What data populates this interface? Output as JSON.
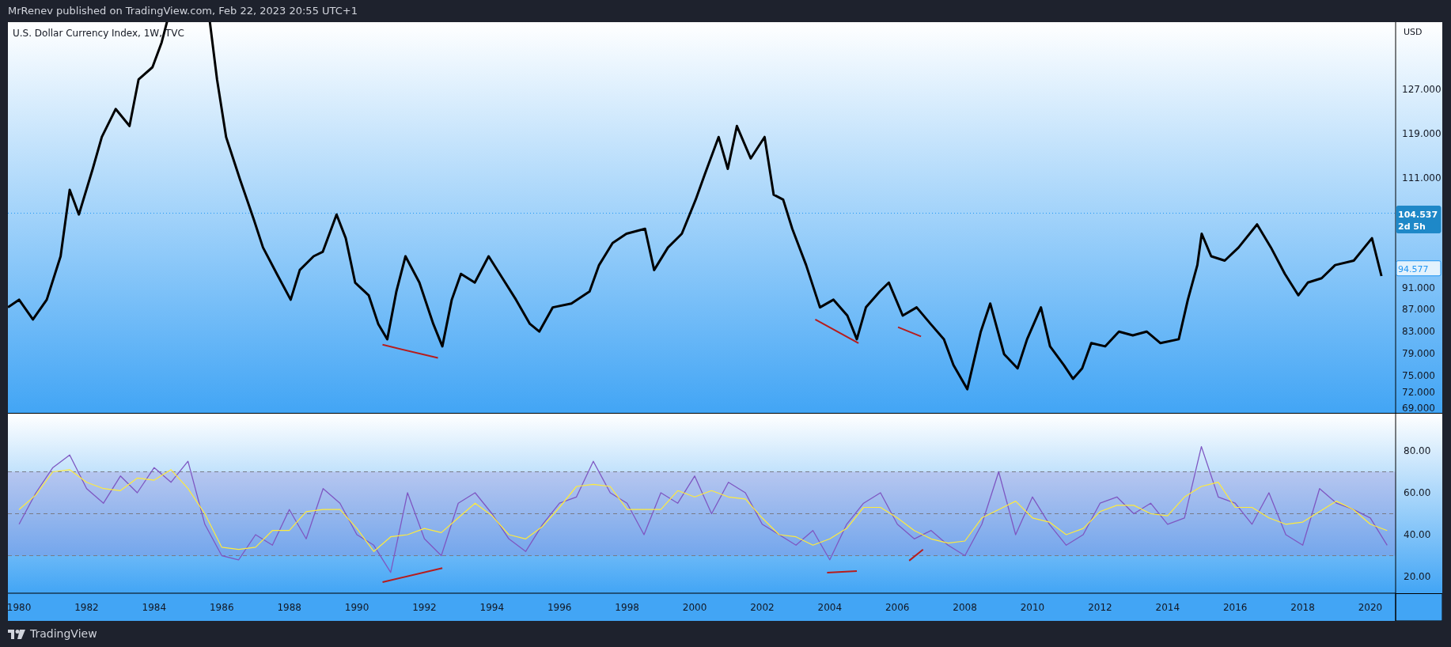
{
  "header": {
    "text": "MrRenev published on TradingView.com, Feb 22, 2023 20:55 UTC+1"
  },
  "price_pane": {
    "unit": "USD",
    "chart_data": {
      "type": "line",
      "title": "U.S. Dollar Currency Index, 1W, TVC",
      "xlim": [
        1979.67,
        2020.75
      ],
      "ylim": [
        68.2,
        139.3
      ],
      "yticks": [
        {
          "value": 127,
          "label": "127.000"
        },
        {
          "value": 119,
          "label": "119.000"
        },
        {
          "value": 111,
          "label": "111.000"
        },
        {
          "value": 91,
          "label": "91.000"
        },
        {
          "value": 87,
          "label": "87.000"
        },
        {
          "value": 83,
          "label": "83.000"
        },
        {
          "value": 79,
          "label": "79.000"
        },
        {
          "value": 75,
          "label": "75.000"
        },
        {
          "value": 72,
          "label": "72.000"
        },
        {
          "value": 69,
          "label": "69.000"
        }
      ],
      "x": [
        1979.67,
        1980.0,
        1980.41,
        1980.82,
        1981.23,
        1981.5,
        1981.77,
        1982.18,
        1982.45,
        1982.86,
        1983.27,
        1983.54,
        1983.95,
        1984.22,
        1984.5,
        1984.77,
        1985.31,
        1985.59,
        1985.86,
        1986.13,
        1986.54,
        1986.95,
        1987.22,
        1987.63,
        1988.04,
        1988.31,
        1988.72,
        1988.99,
        1989.4,
        1989.67,
        1989.95,
        1990.35,
        1990.63,
        1990.9,
        1991.17,
        1991.44,
        1991.85,
        1992.26,
        1992.53,
        1992.81,
        1993.08,
        1993.49,
        1993.9,
        1994.31,
        1994.71,
        1995.12,
        1995.4,
        1995.8,
        1996.35,
        1996.89,
        1997.17,
        1997.57,
        1997.98,
        1998.53,
        1998.8,
        1999.21,
        1999.62,
        2000.03,
        2000.3,
        2000.71,
        2000.98,
        2001.25,
        2001.66,
        2002.07,
        2002.34,
        2002.62,
        2002.89,
        2003.3,
        2003.71,
        2004.11,
        2004.52,
        2004.8,
        2005.07,
        2005.48,
        2005.75,
        2006.16,
        2006.57,
        2006.98,
        2007.38,
        2007.66,
        2008.07,
        2008.47,
        2008.75,
        2009.16,
        2009.56,
        2009.84,
        2010.25,
        2010.52,
        2010.93,
        2011.2,
        2011.47,
        2011.74,
        2012.15,
        2012.56,
        2012.97,
        2013.38,
        2013.79,
        2014.33,
        2014.6,
        2014.88,
        2015.01,
        2015.29,
        2015.69,
        2016.1,
        2016.65,
        2017.06,
        2017.47,
        2017.87,
        2018.15,
        2018.56,
        2018.96,
        2019.51,
        2020.05,
        2020.33
      ],
      "series": [
        {
          "color": "#000000",
          "values": [
            87.4,
            88.8,
            85.2,
            88.8,
            96.7,
            108.8,
            104.3,
            112.6,
            118.4,
            123.5,
            120.4,
            128.9,
            131.1,
            135.6,
            null,
            null,
            null,
            null,
            128.9,
            118.4,
            110.7,
            103.4,
            98.3,
            93.5,
            88.8,
            94.2,
            96.7,
            97.5,
            104.3,
            100.0,
            91.9,
            89.6,
            84.4,
            81.6,
            90.3,
            96.7,
            91.9,
            84.4,
            80.3,
            88.8,
            93.5,
            91.9,
            96.7,
            92.7,
            88.8,
            84.4,
            83.0,
            87.4,
            88.1,
            90.3,
            95.1,
            99.1,
            100.8,
            101.7,
            94.2,
            98.3,
            100.8,
            107.0,
            111.6,
            118.4,
            112.6,
            120.4,
            114.5,
            118.4,
            107.9,
            107.0,
            101.7,
            95.1,
            87.4,
            88.8,
            85.9,
            81.6,
            87.4,
            90.3,
            91.9,
            85.9,
            87.4,
            84.4,
            81.6,
            76.9,
            72.5,
            83.0,
            88.1,
            78.9,
            76.3,
            81.6,
            87.4,
            80.3,
            76.9,
            74.4,
            76.3,
            80.9,
            80.3,
            83.0,
            82.3,
            83.0,
            80.9,
            81.6,
            88.8,
            95.1,
            100.8,
            96.7,
            95.9,
            98.3,
            102.5,
            98.3,
            93.5,
            89.6,
            91.9,
            92.7,
            95.1,
            95.9,
            100.0,
            93.1
          ]
        }
      ],
      "ref_lines": [
        {
          "axis": "y",
          "value": 104.537,
          "color": "#2196f3"
        }
      ]
    },
    "badges": [
      {
        "filled": true,
        "lines": [
          "104.537",
          "2d 5h"
        ]
      },
      {
        "filled": false,
        "lines": [
          "94.577"
        ]
      }
    ]
  },
  "rsi_pane": {
    "chart_data": {
      "type": "line",
      "xlim": [
        1979.67,
        2020.75
      ],
      "ylim": [
        12.1,
        97.7
      ],
      "yticks": [
        {
          "value": 80,
          "label": "80.00"
        },
        {
          "value": 60,
          "label": "60.00"
        },
        {
          "value": 40,
          "label": "40.00"
        },
        {
          "value": 20,
          "label": "20.00"
        }
      ],
      "xticks": [
        1980,
        1982,
        1984,
        1986,
        1988,
        1990,
        1992,
        1994,
        1996,
        1998,
        2000,
        2002,
        2004,
        2006,
        2008,
        2010,
        2012,
        2014,
        2016,
        2018,
        2020
      ],
      "x": [
        1980,
        1980.5,
        1981,
        1981.5,
        1982,
        1982.5,
        1983,
        1983.5,
        1984,
        1984.5,
        1985,
        1985.5,
        1986,
        1986.5,
        1987,
        1987.5,
        1988,
        1988.5,
        1989,
        1989.5,
        1990,
        1990.5,
        1991,
        1991.5,
        1992,
        1992.5,
        1993,
        1993.5,
        1994,
        1994.5,
        1995,
        1995.5,
        1996,
        1996.5,
        1997,
        1997.5,
        1998,
        1998.5,
        1999,
        1999.5,
        2000,
        2000.5,
        2001,
        2001.5,
        2002,
        2002.5,
        2003,
        2003.5,
        2004,
        2004.5,
        2005,
        2005.5,
        2006,
        2006.5,
        2007,
        2007.5,
        2008,
        2008.5,
        2009,
        2009.5,
        2010,
        2010.5,
        2011,
        2011.5,
        2012,
        2012.5,
        2013,
        2013.5,
        2014,
        2014.5,
        2015,
        2015.5,
        2016,
        2016.5,
        2017,
        2017.5,
        2018,
        2018.5,
        2019,
        2019.5,
        2020,
        2020.5
      ],
      "series": [
        {
          "color": "#7e57c2",
          "values": [
            45,
            60,
            72,
            78,
            62,
            55,
            68,
            60,
            72,
            65,
            75,
            45,
            30,
            28,
            40,
            35,
            52,
            38,
            62,
            55,
            40,
            35,
            22,
            60,
            38,
            30,
            55,
            60,
            50,
            38,
            32,
            45,
            55,
            58,
            75,
            60,
            55,
            40,
            60,
            55,
            68,
            50,
            65,
            60,
            45,
            40,
            35,
            42,
            28,
            45,
            55,
            60,
            45,
            38,
            42,
            35,
            30,
            45,
            70,
            40,
            58,
            45,
            35,
            40,
            55,
            58,
            50,
            55,
            45,
            48,
            82,
            58,
            55,
            45,
            60,
            40,
            35,
            62,
            55,
            52,
            48,
            35
          ]
        },
        {
          "color": "#ffeb3b",
          "values": [
            52,
            59,
            70,
            71,
            65,
            62,
            61,
            67,
            66,
            71,
            62,
            50,
            34,
            33,
            34,
            42,
            42,
            51,
            52,
            52,
            43,
            32,
            39,
            40,
            43,
            41,
            48,
            55,
            49,
            40,
            38,
            44,
            53,
            63,
            64,
            63,
            52,
            52,
            52,
            61,
            58,
            61,
            58,
            57,
            48,
            40,
            39,
            35,
            38,
            43,
            53,
            53,
            48,
            42,
            38,
            36,
            37,
            48,
            52,
            56,
            48,
            46,
            40,
            43,
            51,
            54,
            54,
            50,
            49,
            58,
            63,
            65,
            53,
            53,
            48,
            45,
            46,
            51,
            56,
            52,
            45,
            42
          ]
        }
      ],
      "bands": [
        {
          "axis": "y",
          "from": 30,
          "to": 70,
          "color": "#9575cd"
        }
      ],
      "ref_lines": [
        {
          "axis": "y",
          "value": 70,
          "color": "#787b86"
        },
        {
          "axis": "y",
          "value": 50,
          "color": "#787b86"
        },
        {
          "axis": "y",
          "value": 30,
          "color": "#787b86"
        }
      ]
    }
  },
  "footer": {
    "brand": "TradingView"
  }
}
